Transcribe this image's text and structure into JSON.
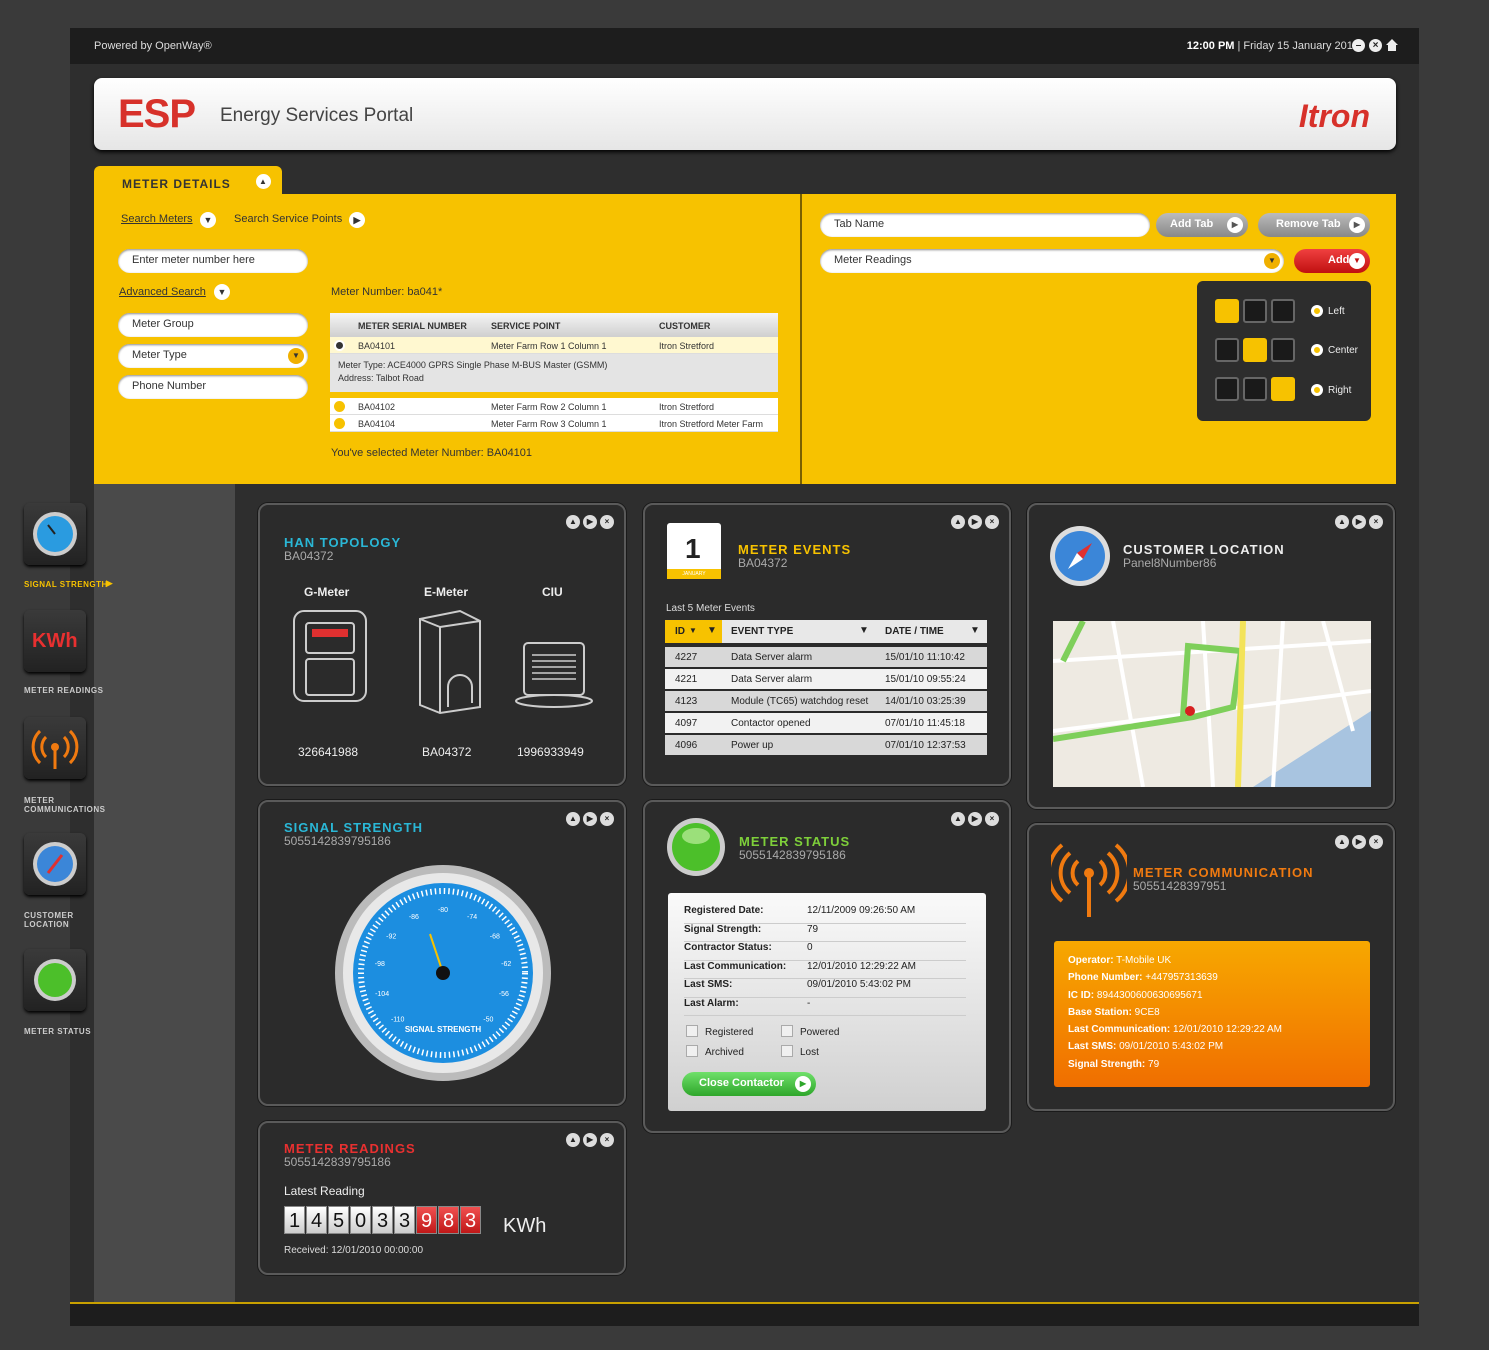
{
  "topbar": {
    "powered": "Powered by OpenWay®",
    "time": "12:00 PM",
    "date": "|  Friday 15 January 2010"
  },
  "header": {
    "logo": "ESP",
    "title": "Energy Services Portal",
    "brand": "Itron"
  },
  "meter_details": {
    "tab_label": "METER DETAILS",
    "search_meters": "Search Meters",
    "search_service_points": "Search Service Points",
    "meter_input_placeholder": "Enter meter number here",
    "advanced_search": "Advanced Search",
    "meter_group": "Meter Group",
    "meter_type": "Meter Type",
    "phone_number": "Phone Number",
    "meter_number_label": "Meter Number: ba041*",
    "table": {
      "headers": [
        "METER SERIAL NUMBER",
        "SERVICE POINT",
        "CUSTOMER"
      ],
      "rows": [
        {
          "serial": "BA04101",
          "service_point": "Meter Farm Row 1 Column 1",
          "customer": "Itron Stretford"
        },
        {
          "serial": "BA04102",
          "service_point": "Meter Farm Row 2 Column 1",
          "customer": "Itron Stretford"
        },
        {
          "serial": "BA04104",
          "service_point": "Meter Farm Row 3 Column 1",
          "customer": "Itron Stretford Meter Farm"
        }
      ],
      "detail_line1": "Meter Type: ACE4000 GPRS Single Phase M-BUS Master (GSMM)",
      "detail_line2": "Address: Talbot Road"
    },
    "selected": "You've selected Meter Number: BA04101"
  },
  "tabs_panel": {
    "tab_name_placeholder": "Tab Name",
    "add_tab": "Add Tab",
    "remove_tab": "Remove Tab",
    "select_value": "Meter Readings",
    "add": "Add",
    "align": [
      "Left",
      "Center",
      "Right"
    ]
  },
  "sidebar": {
    "items": [
      {
        "label": "SIGNAL STRENGTH"
      },
      {
        "label": "METER READINGS"
      },
      {
        "label": "METER COMMUNICATIONS"
      },
      {
        "label": "CUSTOMER LOCATION"
      },
      {
        "label": "METER STATUS"
      }
    ],
    "kwh_icon_text": "KWh"
  },
  "han": {
    "title": "HAN TOPOLOGY",
    "id": "BA04372",
    "devices": [
      {
        "name": "G-Meter",
        "value": "326641988"
      },
      {
        "name": "E-Meter",
        "value": "BA04372"
      },
      {
        "name": "CIU",
        "value": "1996933949"
      }
    ]
  },
  "events": {
    "title": "METER EVENTS",
    "id": "BA04372",
    "calendar_day": "1",
    "calendar_month": "JANUARY",
    "subtitle": "Last 5 Meter Events",
    "headers": [
      "ID",
      "EVENT TYPE",
      "DATE / TIME"
    ],
    "rows": [
      {
        "id": "4227",
        "type": "Data Server alarm",
        "date": "15/01/10 11:10:42"
      },
      {
        "id": "4221",
        "type": "Data Server alarm",
        "date": "15/01/10 09:55:24"
      },
      {
        "id": "4123",
        "type": "Module (TC65) watchdog reset",
        "date": "14/01/10 03:25:39"
      },
      {
        "id": "4097",
        "type": "Contactor opened",
        "date": "07/01/10 11:45:18"
      },
      {
        "id": "4096",
        "type": "Power up",
        "date": "07/01/10 12:37:53"
      }
    ]
  },
  "location": {
    "title": "CUSTOMER LOCATION",
    "id": "Panel8Number86"
  },
  "signal": {
    "title": "SIGNAL STRENGTH",
    "id": "5055142839795186",
    "gauge_label": "SIGNAL STRENGTH",
    "gauge_ticks": [
      "-110",
      "-104",
      "-98",
      "-92",
      "-86",
      "-80",
      "-74",
      "-68",
      "-62",
      "-56",
      "-50"
    ]
  },
  "status": {
    "title": "METER STATUS",
    "id": "5055142839795186",
    "rows": [
      {
        "label": "Registered Date:",
        "value": "12/11/2009 09:26:50 AM"
      },
      {
        "label": "Signal Strength:",
        "value": "79"
      },
      {
        "label": "Contractor Status:",
        "value": "0"
      },
      {
        "label": "Last Communication:",
        "value": "12/01/2010 12:29:22 AM"
      },
      {
        "label": "Last SMS:",
        "value": "09/01/2010 5:43:02 PM"
      },
      {
        "label": "Last Alarm:",
        "value": "-"
      }
    ],
    "checks": [
      "Registered",
      "Powered",
      "Archived",
      "Lost"
    ],
    "button": "Close Contactor"
  },
  "comm": {
    "title": "METER COMMUNICATION",
    "id": "50551428397951",
    "lines": [
      {
        "label": "Operator:",
        "value": " T-Mobile UK"
      },
      {
        "label": "Phone Number:",
        "value": " +447957313639"
      },
      {
        "label": "IC ID:",
        "value": " 8944300600630695671"
      },
      {
        "label": "Base Station:",
        "value": " 9CE8"
      },
      {
        "label": "Last Communication:",
        "value": " 12/01/2010 12:29:22 AM"
      },
      {
        "label": "Last SMS:",
        "value": " 09/01/2010 5:43:02 PM"
      },
      {
        "label": "Signal Strength:",
        "value": " 79"
      }
    ]
  },
  "readings": {
    "title": "METER READINGS",
    "id": "5055142839795186",
    "latest": "Latest Reading",
    "digits": [
      "1",
      "4",
      "5",
      "0",
      "3",
      "3",
      "9",
      "8",
      "3"
    ],
    "unit": "KWh",
    "received": "Received: 12/01/2010 00:00:00"
  },
  "colors": {
    "yellow": "#f7c200",
    "red": "#d7312a",
    "orange": "#f06e00",
    "cyan": "#2ab7d6"
  }
}
